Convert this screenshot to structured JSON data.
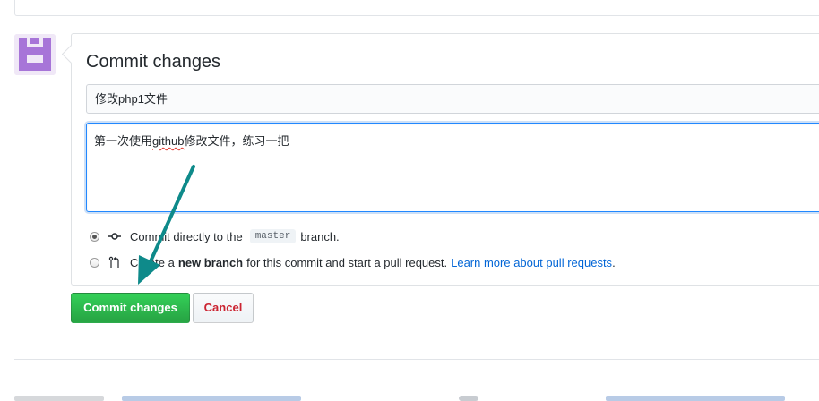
{
  "form": {
    "title": "Commit changes",
    "summary_value": "修改php1文件",
    "description_prefix": "第一次使用",
    "description_misspelled": "github",
    "description_suffix": "修改文件，练习一把"
  },
  "options": {
    "direct": {
      "checked": true,
      "text_before": "Commit directly to the",
      "branch_name": "master",
      "text_after": "branch."
    },
    "new_branch": {
      "checked": false,
      "text_before": "Create a",
      "bold_text": "new branch",
      "text_after": "for this commit and start a pull request.",
      "link_text": "Learn more about pull requests"
    }
  },
  "buttons": {
    "commit_label": "Commit changes",
    "cancel_label": "Cancel"
  },
  "colors": {
    "primary_green": "#28a745",
    "danger_red": "#cb2431",
    "link_blue": "#0366d6",
    "annotation_arrow": "#0e8a8a",
    "avatar_purple": "#a775d8"
  },
  "icons": {
    "avatar": "identicon",
    "direct_commit": "git-commit-icon",
    "new_branch": "git-pull-request-icon"
  }
}
